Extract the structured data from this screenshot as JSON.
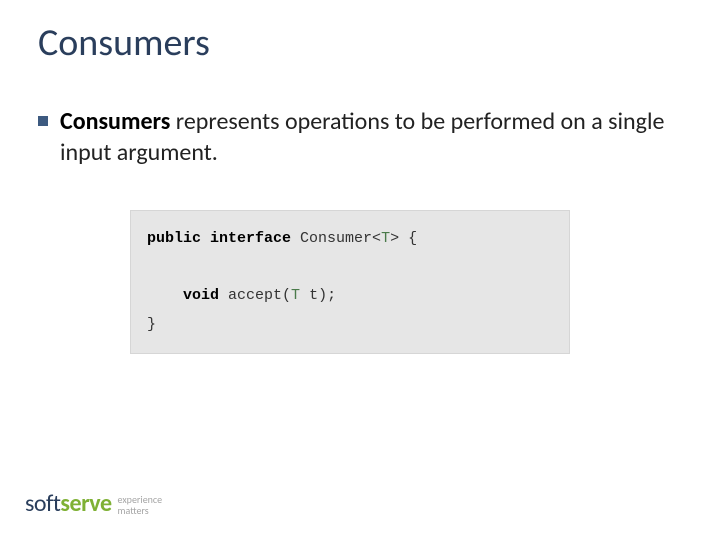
{
  "title": "Consumers",
  "bullet": {
    "bold": "Consumers",
    "rest": " represents operations to be performed on a single input argument."
  },
  "code": {
    "kw_public": "public",
    "kw_interface": "interface",
    "name": " Consumer<",
    "generic": "T",
    "after_generic": "> {",
    "kw_void": "void",
    "method": " accept(",
    "param_type": "T",
    "param_rest": " t);",
    "close": "}"
  },
  "logo": {
    "soft": "soft",
    "serve": "serve",
    "tag1": "experience",
    "tag2": "matters"
  }
}
